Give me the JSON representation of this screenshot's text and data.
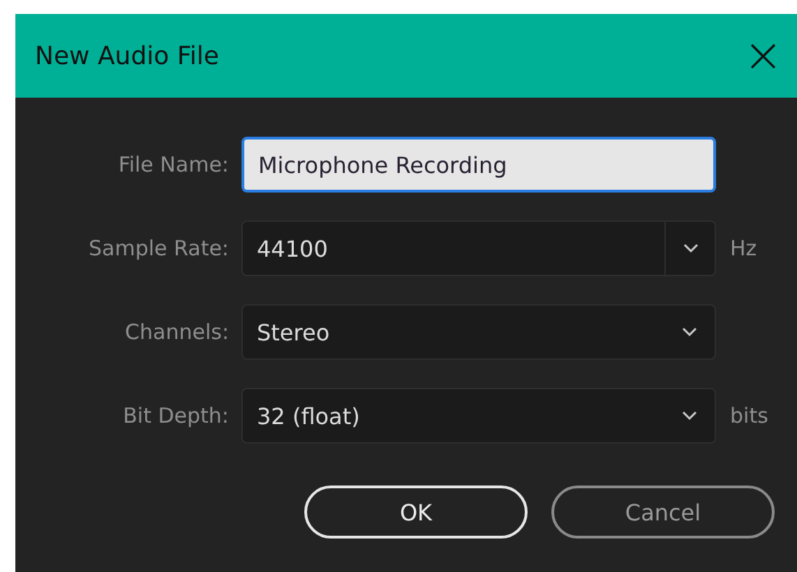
{
  "window": {
    "title": "New Audio File",
    "close": "×"
  },
  "fields": [
    {
      "label": "File Name:",
      "kind": "text",
      "value": "Microphone Recording",
      "focused": true
    },
    {
      "label": "Sample Rate:",
      "kind": "combo",
      "value": "44100",
      "unit": "Hz",
      "focused": false
    },
    {
      "label": "Channels:",
      "kind": "select",
      "value": "Stereo",
      "focused": false
    },
    {
      "label": "Bit Depth:",
      "kind": "select",
      "value": "32 (float)",
      "unit": "bits",
      "focused": false
    }
  ],
  "buttons": [
    {
      "label": "OK",
      "default": true
    },
    {
      "label": "Cancel",
      "default": false
    }
  ]
}
